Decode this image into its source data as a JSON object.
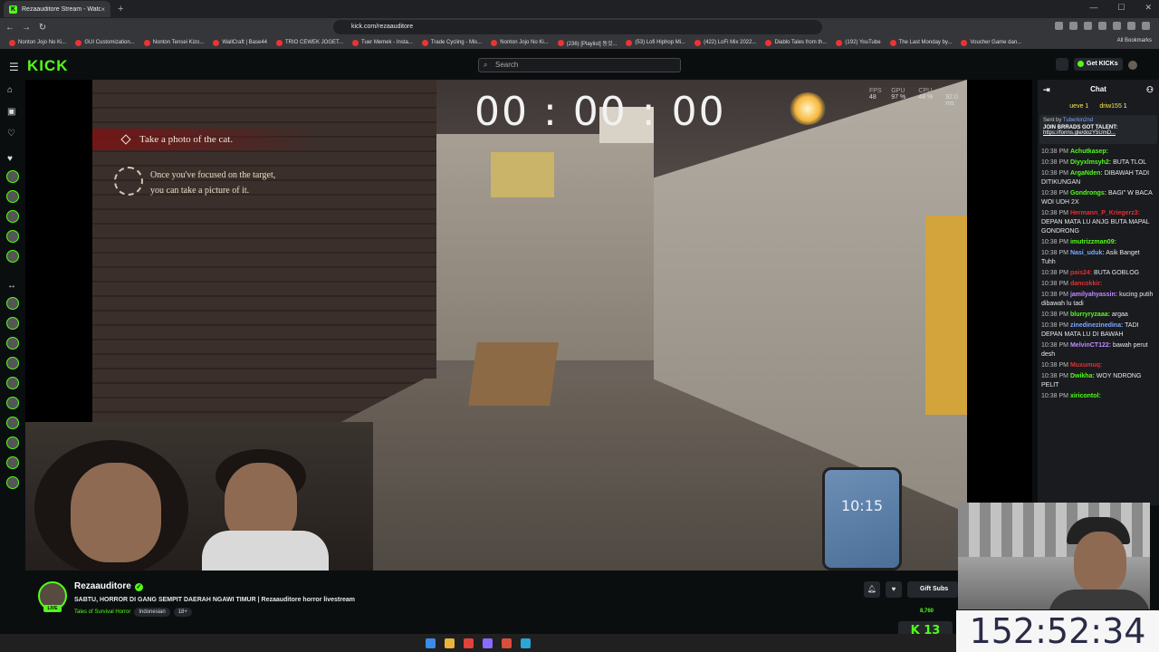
{
  "browser": {
    "tab_title": "Rezaauditore Stream - Watch",
    "tab_close": "×",
    "new_tab": "+",
    "url": "kick.com/rezaauditore",
    "bookmarks": [
      "Nonton Jojo No Ki...",
      "GUI Customization...",
      "Nonton Tensei Kizo...",
      "WallCraft | Base44",
      "TRIO CEWEK JOGET...",
      "Tuer Memek - Insta...",
      "Trade Cycling - Mis...",
      "Nonton Jojo No Ki...",
      "(236) [Playlist] 동것...",
      "(53) Lofi Hiphop Mi...",
      "(422) LoFi Mix 2022...",
      "Diablo Tales from th...",
      "(192) YouTube",
      "The Last Monday by...",
      "Voucher Game dan..."
    ],
    "all_bookmarks": "All Bookmarks"
  },
  "kick": {
    "logo": "KICK",
    "search_placeholder": "Search",
    "get_kicks": "Get KICKs"
  },
  "game": {
    "timer": "00 : 00 : 00",
    "stats": {
      "fps_label": "FPS",
      "fps": "48",
      "gpu_label": "GPU",
      "gpu": "97 %",
      "cpu_label": "CPU",
      "cpu": "48 %",
      "lat_label": "LAT",
      "lat": "92.0 ms"
    },
    "objective": "Take a photo of the cat.",
    "hint_line1": "Once you've focused on the target,",
    "hint_line2": "you can take a picture of it.",
    "phone_time": "10:15"
  },
  "chat": {
    "title": "Chat",
    "gifters": [
      "ueve",
      "driw155"
    ],
    "gifter_counts": [
      "1",
      "1"
    ],
    "pinned_by_label": "Sent by",
    "pinned_by": "Tuberkin2nd",
    "pinned_text": "JOIN BRRADS GOT TALENT:",
    "pinned_link": "https://forms.gle/dozY5UmD...",
    "messages": [
      {
        "time": "10:38 PM",
        "user": "Achutkasep:",
        "text": "",
        "color": "#53fc18"
      },
      {
        "time": "10:38 PM",
        "user": "Diyyxlmsyh2:",
        "text": "BUTA TLOL",
        "color": "#53fc18"
      },
      {
        "time": "10:38 PM",
        "user": "ArgaNden:",
        "text": "DIBAWAH TADI DITIKUNGAN",
        "color": "#53fc18"
      },
      {
        "time": "10:38 PM",
        "user": "Gondrongs:",
        "text": "BAGI\" W BACA WOI UDH 2X",
        "color": "#53fc18"
      },
      {
        "time": "10:38 PM",
        "user": "Hermann_P_Kriegerz3:",
        "text": "DEPAN MATA LU ANJG BUTA MAPAL GONDRONG",
        "color": "#e03030"
      },
      {
        "time": "10:38 PM",
        "user": "imutrizzman09:",
        "text": "",
        "color": "#53fc18"
      },
      {
        "time": "10:38 PM",
        "user": "Nasi_uduk:",
        "text": "Asik Banget Tuhh",
        "color": "#7aa9ff"
      },
      {
        "time": "10:38 PM",
        "user": "pais24:",
        "text": "BUTA GOBLOG",
        "color": "#e03030"
      },
      {
        "time": "10:38 PM",
        "user": "dancokkir:",
        "text": "",
        "color": "#e03030"
      },
      {
        "time": "10:38 PM",
        "user": "jamilyahyassin:",
        "text": "kucing putih dibawah lu tadi",
        "color": "#c08bff"
      },
      {
        "time": "10:38 PM",
        "user": "blurryryzaaa:",
        "text": "argaa",
        "color": "#53fc18"
      },
      {
        "time": "10:38 PM",
        "user": "zinedinezinedina:",
        "text": "TADI DEPAN MATA LU DI BAWAH",
        "color": "#7aa9ff"
      },
      {
        "time": "10:38 PM",
        "user": "MelvinCT122:",
        "text": "bawah perut desh",
        "color": "#c08bff"
      },
      {
        "time": "10:38 PM",
        "user": "Muxumuq:",
        "text": "",
        "color": "#e03030"
      },
      {
        "time": "10:38 PM",
        "user": "Dwikha:",
        "text": "WOY NDRONG PELIT",
        "color": "#53fc18"
      },
      {
        "time": "10:38 PM",
        "user": "xiricontol:",
        "text": "",
        "color": "#53fc18"
      }
    ]
  },
  "streamer": {
    "name": "Rezaauditore",
    "live": "LIVE",
    "title": "SABTU, HORROR DI GANG SEMPIT DAERAH NGAWI TIMUR | Rezaauditore horror livestream",
    "category": "Tales of Survival Horror",
    "tags": [
      "Indonesian",
      "18+"
    ],
    "gift_subs": "Gift Subs",
    "viewers": "8,760"
  },
  "overlay": {
    "kick_count": "13",
    "big_clock": "152:52:34"
  },
  "colors": {
    "accent": "#53fc18",
    "bg": "#0b0e0f",
    "panel": "#191b1f"
  }
}
